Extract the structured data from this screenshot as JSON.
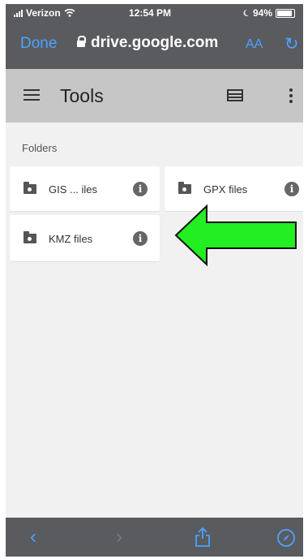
{
  "status": {
    "carrier": "Verizon",
    "time": "12:54 PM",
    "battery": "94%"
  },
  "browser": {
    "done_label": "Done",
    "url": "drive.google.com",
    "text_size_label": "AA"
  },
  "toolbar": {
    "title": "Tools"
  },
  "section": {
    "folders_label": "Folders"
  },
  "folders": [
    {
      "name": "GIS ... iles"
    },
    {
      "name": "GPX files"
    },
    {
      "name": "KMZ files"
    }
  ],
  "icons": {
    "info": "i"
  },
  "colors": {
    "browser_bar": "#5a5b5f",
    "link_blue": "#4aa3ff",
    "app_toolbar": "#c6c6c6",
    "page_bg": "#f1f1f1",
    "annotation_arrow": "#22ee22"
  }
}
